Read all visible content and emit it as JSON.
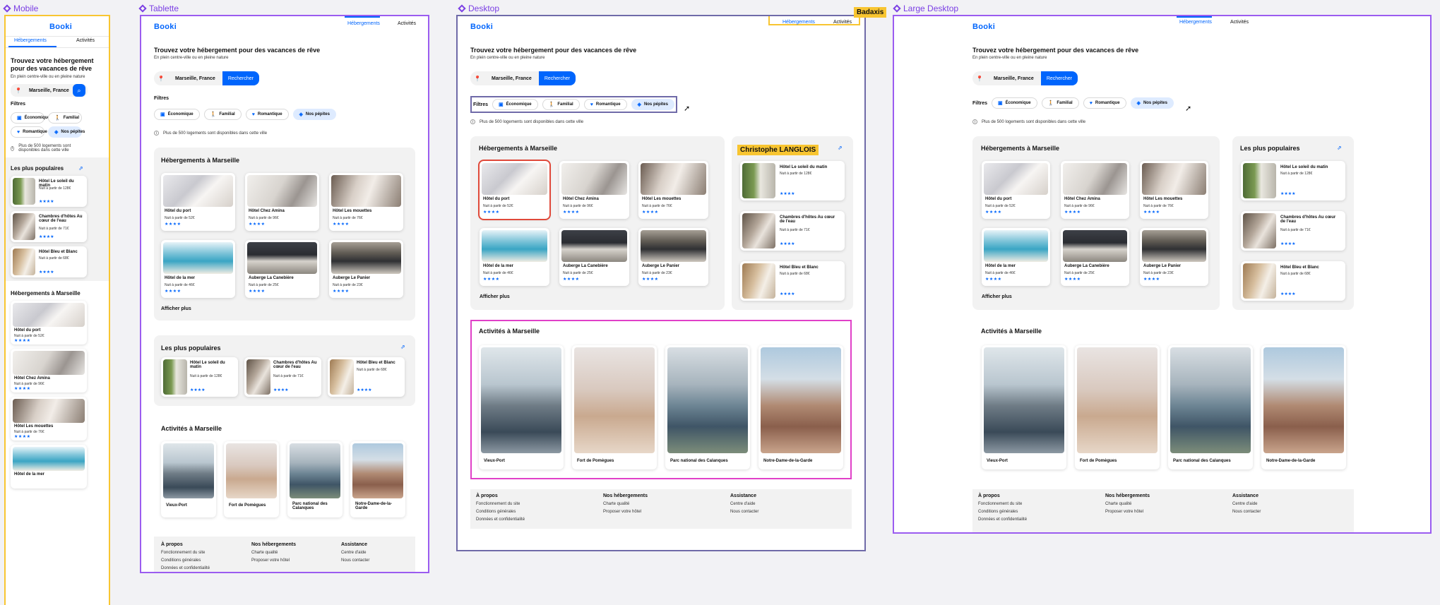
{
  "frames": {
    "mobile": "Mobile",
    "tablet": "Tablette",
    "desktop": "Desktop",
    "large": "Large Desktop"
  },
  "colors": {
    "brand": "#0065fc",
    "frame_purple": "#9b5cf0",
    "frame_yellow": "#f8c531",
    "frame_pink": "#e040c8",
    "frame_slate": "#6f6aa8",
    "selection_red": "#e0493a"
  },
  "brand": {
    "logo": "Booki"
  },
  "nav": {
    "hebergements": "Hébergements",
    "activites": "Activités"
  },
  "hero": {
    "title": "Trouvez votre hébergement pour des vacances de rêve",
    "subtitle": "En plein centre-ville ou en pleine nature"
  },
  "search": {
    "location": "Marseille, France",
    "button": "Rechercher",
    "pin_icon": "location-pin-icon"
  },
  "filters": {
    "label": "Filtres",
    "chips": [
      {
        "label": "Économique",
        "icon": "money-icon",
        "selected": false
      },
      {
        "label": "Familial",
        "icon": "child-icon",
        "selected": false
      },
      {
        "label": "Romantique",
        "icon": "heart-icon",
        "selected": false
      },
      {
        "label": "Nos pépites",
        "icon": "gem-icon",
        "selected": true
      }
    ]
  },
  "info": {
    "text": "Plus de 500 logements sont disponibles dans cette ville"
  },
  "accommodations": {
    "title": "Hébergements à Marseille",
    "more": "Afficher plus",
    "items": [
      {
        "name": "Hôtel du port",
        "price": "Nuit à partir de 52€",
        "stars": "★★★★"
      },
      {
        "name": "Hôtel Chez Amina",
        "price": "Nuit à partir de 96€",
        "stars": "★★★★"
      },
      {
        "name": "Hôtel Les mouettes",
        "price": "Nuit à partir de 76€",
        "stars": "★★★★"
      },
      {
        "name": "Hôtel de la mer",
        "price": "Nuit à partir de 46€",
        "stars": "★★★★"
      },
      {
        "name": "Auberge La Canebière",
        "price": "Nuit à partir de 25€",
        "stars": "★★★★"
      },
      {
        "name": "Auberge Le Panier",
        "price": "Nuit à partir de 23€",
        "stars": "★★★★"
      }
    ]
  },
  "popular": {
    "title": "Les plus populaires",
    "items": [
      {
        "name": "Hôtel Le soleil du matin",
        "price": "Nuit à partir de 128€",
        "stars": "★★★★"
      },
      {
        "name": "Chambres d'hôtes Au cœur de l'eau",
        "price": "Nuit à partir de 71€",
        "stars": "★★★★"
      },
      {
        "name": "Hôtel Bleu et Blanc",
        "price": "Nuit à partir de 68€",
        "stars": "★★★★"
      }
    ]
  },
  "activities": {
    "title": "Activités à Marseille",
    "items": [
      {
        "name": "Vieux-Port"
      },
      {
        "name": "Fort de Pomègues"
      },
      {
        "name": "Parc national des Calanques"
      },
      {
        "name": "Notre-Dame-de-la-Garde"
      }
    ]
  },
  "footer": {
    "col1": {
      "title": "À propos",
      "links": [
        "Fonctionnement du site",
        "Conditions générales",
        "Données et confidentialité"
      ]
    },
    "col2": {
      "title": "Nos hébergements",
      "links": [
        "Charte qualité",
        "Proposer votre hôtel"
      ]
    },
    "col3": {
      "title": "Assistance",
      "links": [
        "Centre d'aide",
        "Nous contacter"
      ]
    }
  },
  "collaborators": {
    "user1": "Badaxis",
    "user2": "Christophe LANGLOIS"
  }
}
